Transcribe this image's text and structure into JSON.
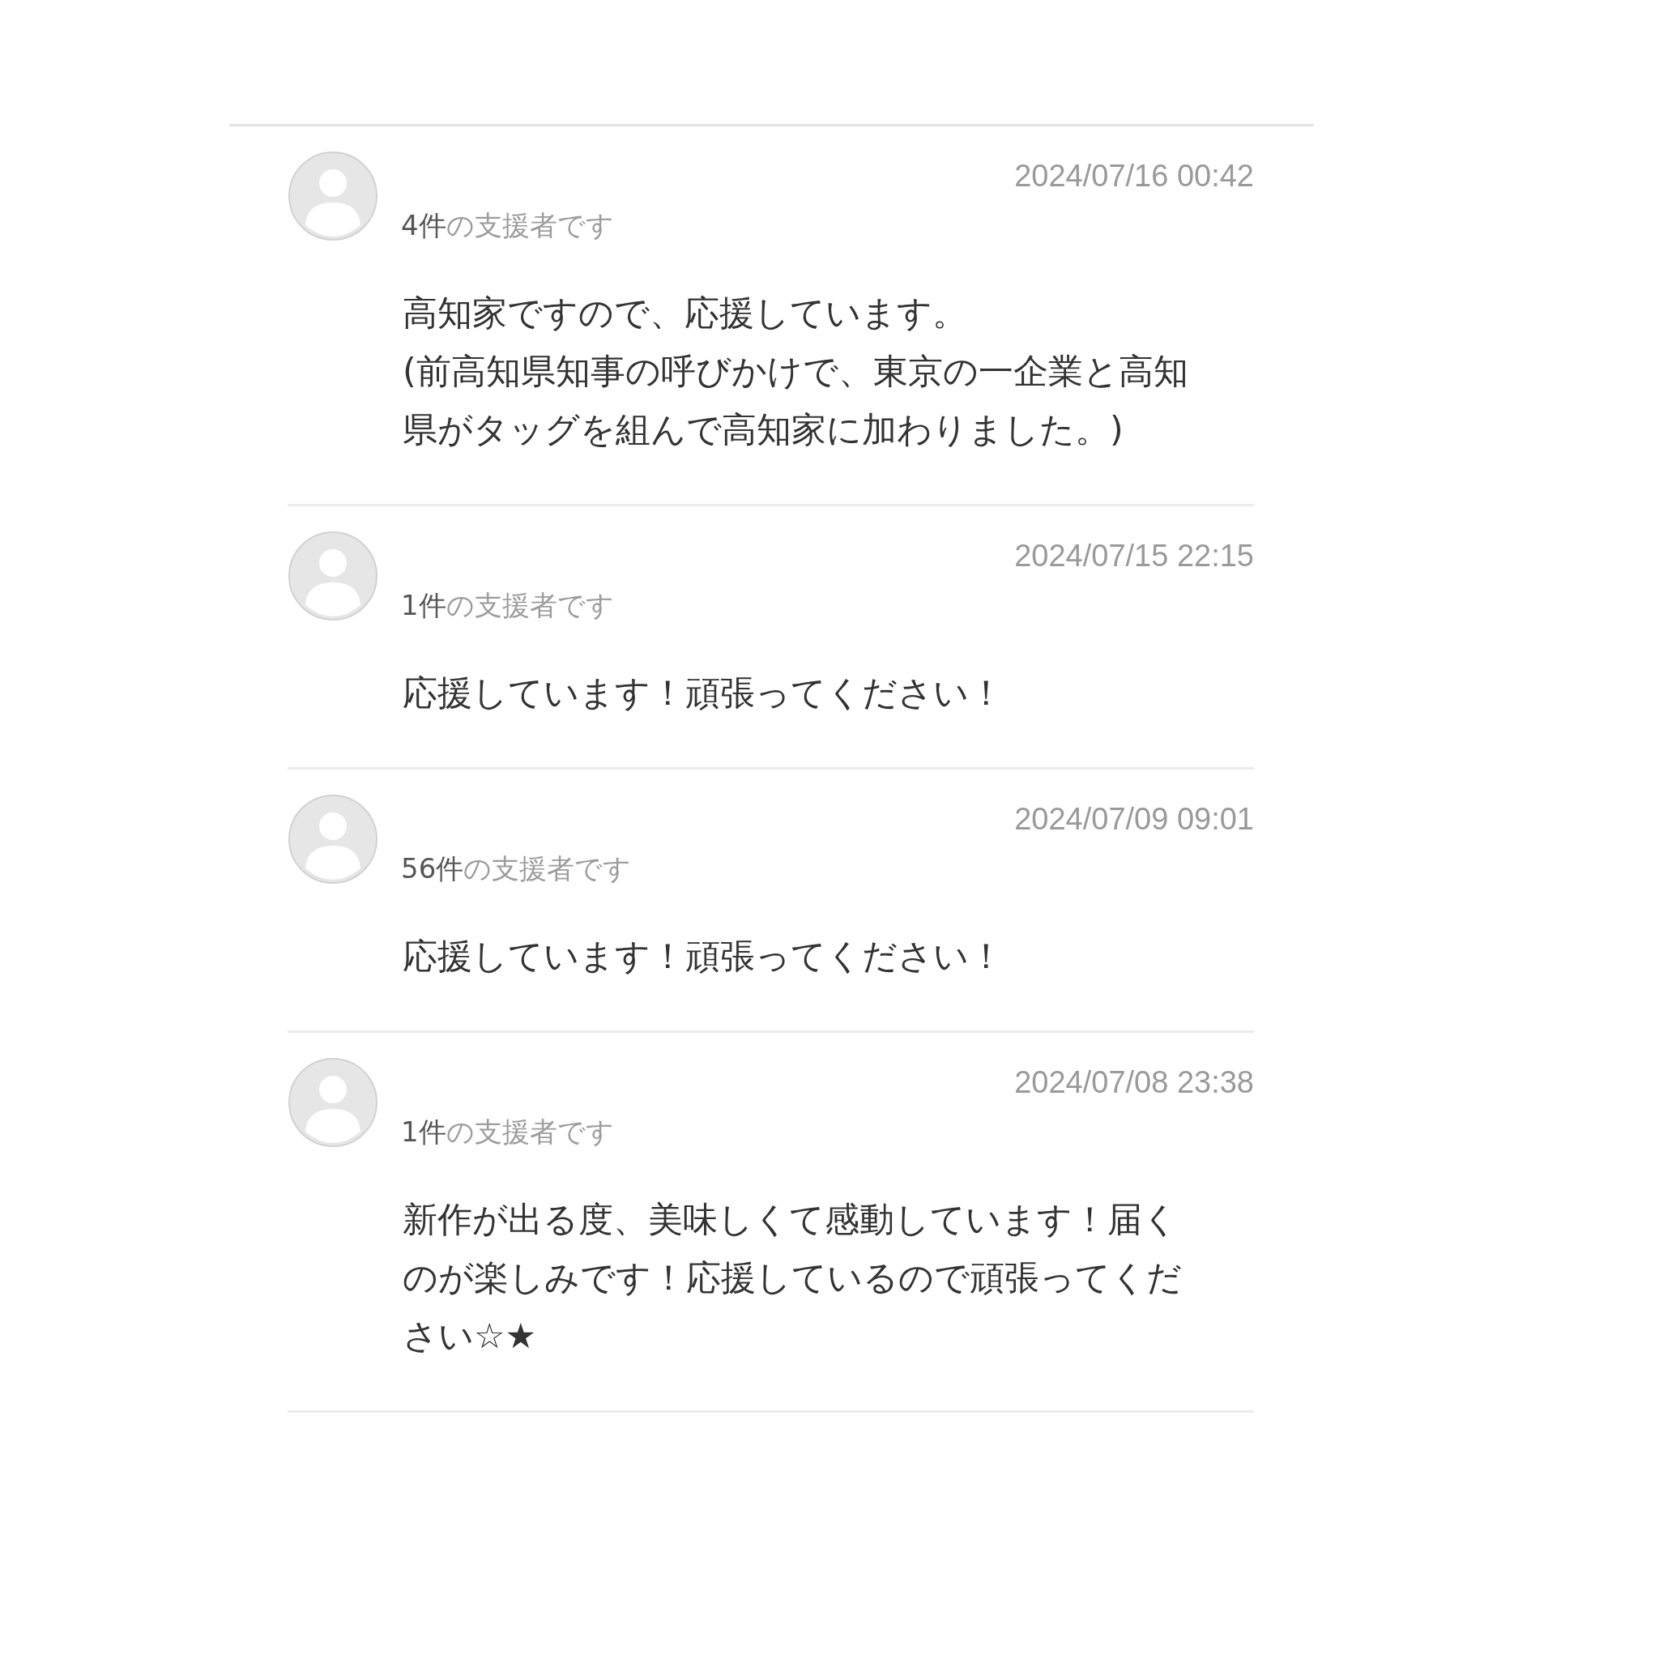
{
  "comments": [
    {
      "date": "2024/07/16 00:42",
      "supporter_count": "4件",
      "supporter_label": "の支援者です",
      "body": [
        "高知家ですので、応援しています。",
        "(前高知県知事の呼びかけで、東京の一企業と高知",
        "県がタッグを組んで高知家に加わりました。)"
      ]
    },
    {
      "date": "2024/07/15 22:15",
      "supporter_count": "1件",
      "supporter_label": "の支援者です",
      "body": [
        "応援しています！頑張ってください！"
      ]
    },
    {
      "date": "2024/07/09 09:01",
      "supporter_count": "56件",
      "supporter_label": "の支援者です",
      "body": [
        "応援しています！頑張ってください！"
      ]
    },
    {
      "date": "2024/07/08 23:38",
      "supporter_count": "1件",
      "supporter_label": "の支援者です",
      "body": [
        "新作が出る度、美味しくて感動しています！届く",
        "のが楽しみです！応援しているので頑張ってくだ",
        "さい☆★"
      ]
    }
  ]
}
